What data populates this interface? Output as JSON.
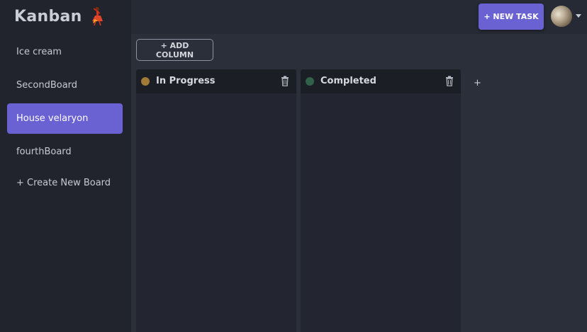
{
  "app": {
    "title": "Kanban"
  },
  "sidebar": {
    "boards": [
      {
        "label": "Ice cream"
      },
      {
        "label": "SecondBoard"
      },
      {
        "label": "House velaryon"
      },
      {
        "label": "fourthBoard"
      }
    ],
    "active_index": 2,
    "create_label": "+ Create New Board"
  },
  "header": {
    "new_task_label": "+ NEW TASK"
  },
  "board": {
    "add_column_label": "+ ADD COLUMN",
    "columns": [
      {
        "title": "In Progress",
        "color": "#a07a37"
      },
      {
        "title": "Completed",
        "color": "#2f6248"
      }
    ],
    "add_plus_label": "+"
  },
  "theme": {
    "accent": "#6a61d3",
    "sidebar_bg": "#21242d",
    "board_bg": "#2b2f3a"
  }
}
